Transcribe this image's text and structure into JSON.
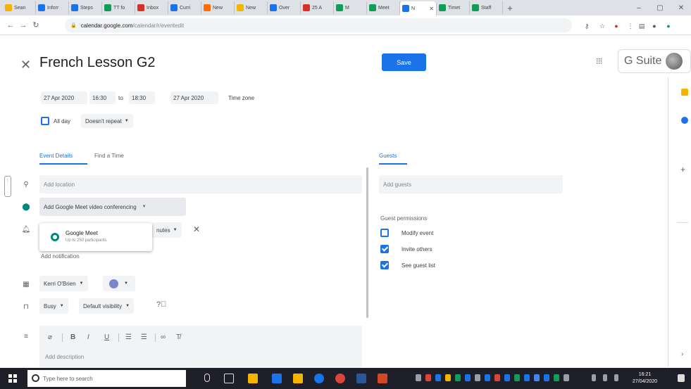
{
  "browser": {
    "tabs": [
      {
        "label": "Sean",
        "color": "#f4b400"
      },
      {
        "label": "Inforr",
        "color": "#1a73e8"
      },
      {
        "label": "Steps",
        "color": "#1a73e8"
      },
      {
        "label": "TT fo",
        "color": "#0f9d58"
      },
      {
        "label": "Inbox",
        "color": "#d93025"
      },
      {
        "label": "Curri",
        "color": "#1a73e8"
      },
      {
        "label": "New",
        "color": "#ff6d00"
      },
      {
        "label": "New",
        "color": "#f4b400"
      },
      {
        "label": "Over",
        "color": "#1a73e8"
      },
      {
        "label": "25 A",
        "color": "#d93025"
      },
      {
        "label": "M",
        "color": "#0f9d58"
      },
      {
        "label": "Meet",
        "color": "#0f9d58"
      },
      {
        "label": "N",
        "color": "#1a73e8"
      },
      {
        "label": "Timet",
        "color": "#0f9d58"
      },
      {
        "label": "Staff",
        "color": "#0f9d58"
      }
    ],
    "new_tab": "+",
    "url_host": "calendar.google.com",
    "url_path": "/calendar/r/eventedit"
  },
  "header": {
    "title": "French Lesson G2",
    "save_label": "Save",
    "brand": "G Suite"
  },
  "when": {
    "start_date": "27 Apr 2020",
    "start_time": "16:30",
    "to": "to",
    "end_time": "18:30",
    "end_date": "27 Apr 2020",
    "timezone": "Time zone",
    "all_day": "All day",
    "repeat": "Doesn't repeat"
  },
  "tabs": {
    "details": "Event Details",
    "find_time": "Find a Time",
    "guests": "Guests"
  },
  "details": {
    "location_placeholder": "Add location",
    "conferencing": "Add Google Meet video conferencing",
    "notification_unit": "nutes",
    "add_notification": "Add notification",
    "calendar_owner": "Kerri O'Brien",
    "busy": "Busy",
    "visibility": "Default visibility",
    "description_placeholder": "Add description"
  },
  "popup": {
    "title": "Google Meet",
    "subtitle": "Up to 250 participants"
  },
  "guests": {
    "placeholder": "Add guests",
    "permissions_heading": "Guest permissions",
    "perms": [
      {
        "label": "Modify event",
        "checked": false
      },
      {
        "label": "Invite others",
        "checked": true
      },
      {
        "label": "See guest list",
        "checked": true
      }
    ]
  },
  "taskbar": {
    "search_placeholder": "Type here to search",
    "time": "16:21",
    "date": "27/04/2020"
  },
  "colors": {
    "accent": "#1a73e8",
    "calendar_color": "#7986cb",
    "meet": "#00897b"
  }
}
